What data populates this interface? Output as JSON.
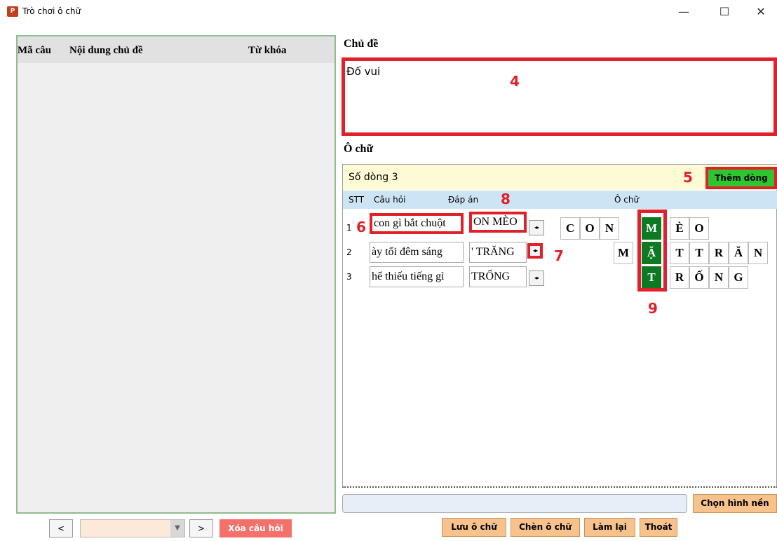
{
  "window": {
    "icon_text": "P",
    "title": "Trò chơi ô chữ",
    "minimize": "—",
    "maximize": "☐",
    "close": "✕"
  },
  "question_list": {
    "columns": [
      "Mã câu",
      "Nội dung chủ đề",
      "Từ khóa"
    ],
    "rows": []
  },
  "navigator": {
    "prev": "<",
    "next": ">",
    "combo_value": "",
    "combo_arrow": "▼",
    "delete_label": "Xóa câu hỏi"
  },
  "topic": {
    "label": "Chủ đề",
    "value": "Đố vui"
  },
  "crossword": {
    "label": "Ô chữ",
    "row_count_label": "Số dòng 3",
    "add_row_label": "Thêm dòng",
    "headers": [
      "STT",
      "Câu hỏi",
      "Đáp án",
      "Ô chữ"
    ],
    "rows": [
      {
        "stt": "1",
        "question": "con gì bắt chuột",
        "answer": "ON MÈO",
        "spin": "◂▸",
        "letters": [
          "C",
          "O",
          "N",
          "M",
          "È",
          "O"
        ]
      },
      {
        "stt": "2",
        "question": "ày tối đêm sáng",
        "answer": "' TRĂNG",
        "spin": "◂▸",
        "letters": [
          "M",
          "Ặ",
          "T",
          "T",
          "R",
          "Ă",
          "N"
        ]
      },
      {
        "stt": "3",
        "question": "hể thiếu tiếng gì",
        "answer": "TRỐNG",
        "spin": "◂▸",
        "letters": [
          "T",
          "R",
          "Ố",
          "N",
          "G"
        ]
      }
    ]
  },
  "annotations": [
    "4",
    "5",
    "6",
    "7",
    "8",
    "9"
  ],
  "background": {
    "path_value": "",
    "choose_label": "Chọn hình nền"
  },
  "actions": {
    "save": "Lưu ô chữ",
    "insert": "Chèn ô chữ",
    "reset": "Làm lại",
    "exit": "Thoát"
  },
  "colors": {
    "highlight_red": "#e0202a",
    "key_green": "#0c7a23",
    "add_green": "#2ec62e",
    "button_orange": "#f7c28c",
    "delete_red": "#f4706b"
  }
}
